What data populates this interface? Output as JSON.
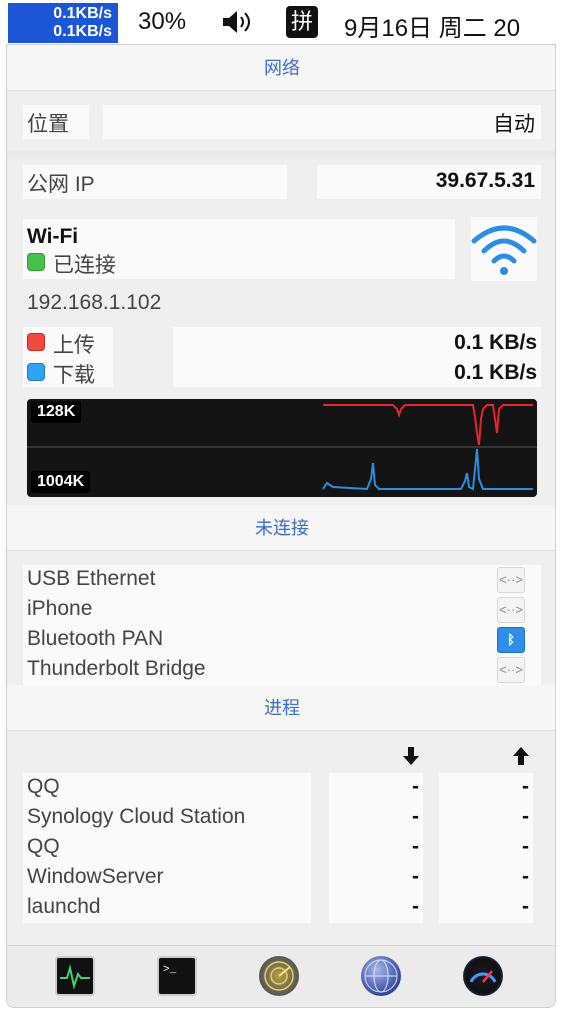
{
  "menubar": {
    "upload_speed": "0.1KB/s",
    "download_speed": "0.1KB/s",
    "battery": "30%",
    "volume_icon": "speaker-icon",
    "ime": "拼",
    "date": "9月16日 周二 20"
  },
  "network": {
    "header": "网络",
    "location_label": "位置",
    "location_value": "自动",
    "public_ip_label": "公网 IP",
    "public_ip_value": "39.67.5.31",
    "wifi_title": "Wi-Fi",
    "wifi_status": "已连接",
    "local_ip": "192.168.1.102",
    "upload_label": "上传",
    "upload_value": "0.1 KB/s",
    "download_label": "下载",
    "download_value": "0.1 KB/s",
    "graph_top_label": "128K",
    "graph_bottom_label": "1004K",
    "colors": {
      "upload": "#e8262a",
      "download": "#2a8fe0",
      "connected": "#48c04c",
      "header": "#3b6fc6"
    }
  },
  "disconnected": {
    "header": "未连接",
    "items": [
      {
        "label": "USB Ethernet",
        "icon": "ethernet-icon"
      },
      {
        "label": "iPhone",
        "icon": "ethernet-icon"
      },
      {
        "label": "Bluetooth PAN",
        "icon": "bluetooth-icon"
      },
      {
        "label": "Thunderbolt Bridge",
        "icon": "ethernet-icon"
      }
    ]
  },
  "processes": {
    "header": "进程",
    "download_col_icon": "arrow-down-icon",
    "upload_col_icon": "arrow-up-icon",
    "rows": [
      {
        "name": "QQ",
        "down": "-",
        "up": "-"
      },
      {
        "name": "Synology Cloud Station",
        "down": "-",
        "up": "-"
      },
      {
        "name": "QQ",
        "down": "-",
        "up": "-"
      },
      {
        "name": "WindowServer",
        "down": "-",
        "up": "-"
      },
      {
        "name": "launchd",
        "down": "-",
        "up": "-"
      }
    ]
  },
  "toolbar": {
    "buttons": [
      "activity-monitor-icon",
      "terminal-icon",
      "network-radar-icon",
      "network-utility-icon",
      "speedtest-icon"
    ]
  }
}
